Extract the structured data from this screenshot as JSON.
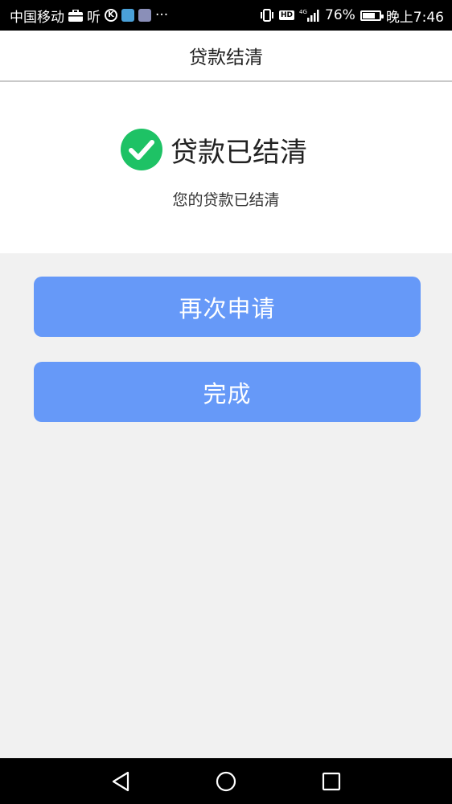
{
  "status_bar": {
    "carrier": "中国移动",
    "ting": "听",
    "k_badge": "K",
    "more": "···",
    "hd": "HD",
    "network": "4G",
    "battery_percent_text": "76%",
    "battery_level": 0.76,
    "time": "晚上7:46"
  },
  "header": {
    "title": "贷款结清"
  },
  "result": {
    "title": "贷款已结清",
    "subtitle": "您的贷款已结清",
    "icon": "check-circle-icon",
    "icon_color": "#1ec265"
  },
  "actions": {
    "reapply_label": "再次申请",
    "done_label": "完成",
    "button_color": "#6699f8"
  },
  "nav": {
    "back": "back-triangle-icon",
    "home": "home-circle-icon",
    "recents": "recents-square-icon"
  }
}
